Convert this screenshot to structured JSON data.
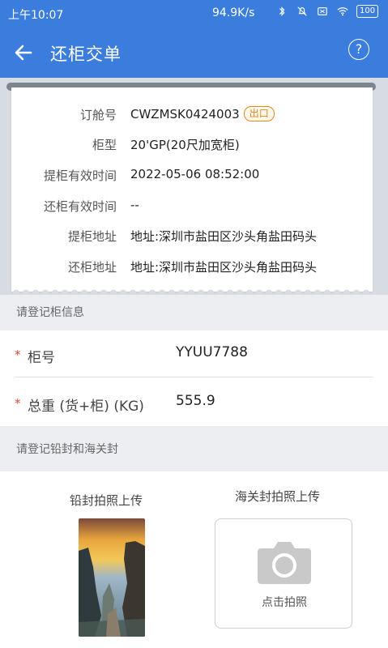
{
  "status": {
    "time": "上午10:07",
    "speed": "94.9K/s",
    "battery": "100"
  },
  "header": {
    "title": "还柜交单",
    "help": "?"
  },
  "ticket": {
    "rows": [
      {
        "label": "订舱号",
        "value": "CWZMSK0424003",
        "badge": "出口"
      },
      {
        "label": "柜型",
        "value": "20'GP(20尺加宽柜)"
      },
      {
        "label": "提柜有效时间",
        "value": "2022-05-06 08:52:00"
      },
      {
        "label": "还柜有效时间",
        "value": "--"
      },
      {
        "label": "提柜地址",
        "value": "地址:深圳市盐田区沙头角盐田码头"
      },
      {
        "label": "还柜地址",
        "value": "地址:深圳市盐田区沙头角盐田码头"
      }
    ]
  },
  "container_section": {
    "title": "请登记柜信息"
  },
  "form": {
    "container_no": {
      "required": "*",
      "label": "柜号",
      "value": "YYUU7788"
    },
    "gross_weight": {
      "required": "*",
      "label": "总重 (货+柜) (KG)",
      "value": "555.9"
    }
  },
  "seal_section": {
    "title": "请登记铅封和海关封"
  },
  "uploads": {
    "lead_seal": {
      "label": "铅封拍照上传"
    },
    "customs_seal": {
      "label": "海关封拍照上传",
      "button": "点击拍照"
    }
  },
  "colors": {
    "primary": "#3b7ddd",
    "badge": "#e08a1e",
    "required": "#e0453a"
  }
}
